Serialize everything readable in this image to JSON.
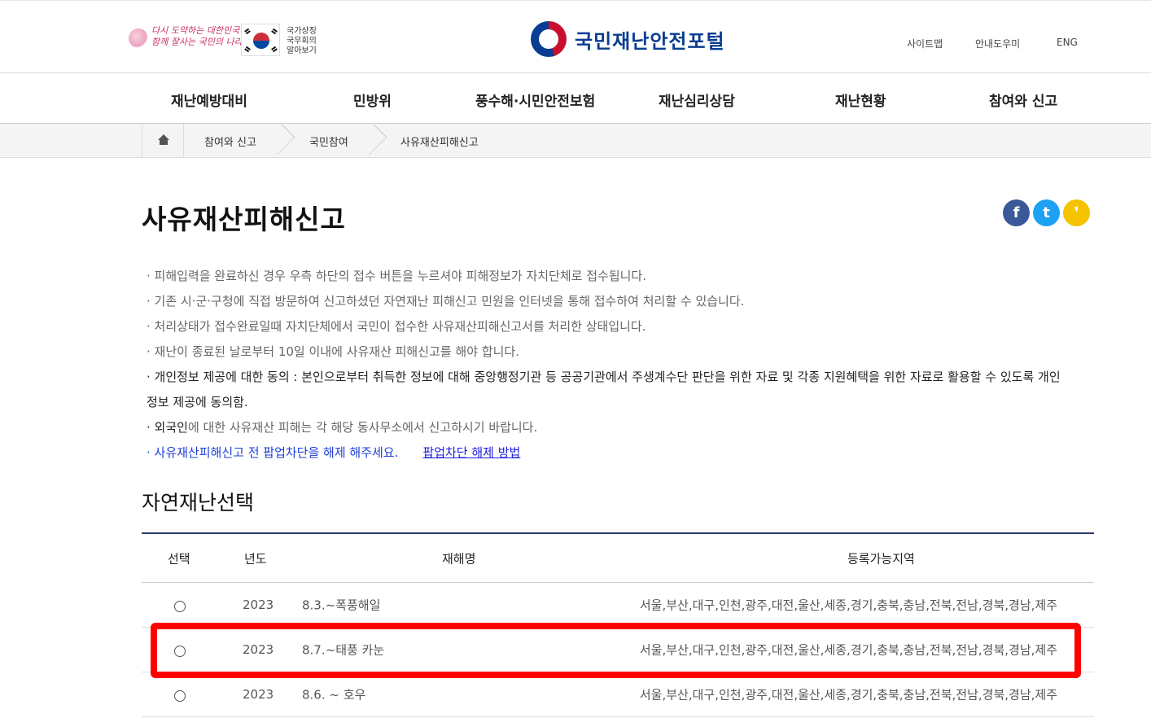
{
  "header": {
    "slogan_lines": [
      "다시 도약하는 대한민국",
      "함께 잘사는 국민의 나라"
    ],
    "symbol_text_lines": [
      "국가상징",
      "국무회의",
      "알아보기"
    ],
    "logo_text": "국민재난안전포털",
    "util_links": [
      "사이트맵",
      "안내도우미",
      "ENG"
    ]
  },
  "gnb": [
    "재난예방대비",
    "민방위",
    "풍수해·시민안전보험",
    "재난심리상담",
    "재난현황",
    "참여와 신고"
  ],
  "breadcrumb": [
    "참여와 신고",
    "국민참여",
    "사유재산피해신고"
  ],
  "page_title": "사유재산피해신고",
  "share": [
    {
      "icon": "facebook-icon",
      "glyph": "f",
      "color": "#3b5998"
    },
    {
      "icon": "twitter-icon",
      "glyph": "t",
      "color": "#1da1f2"
    },
    {
      "icon": "kakaostory-icon",
      "glyph": "❜",
      "color": "#f5c300"
    }
  ],
  "notices": [
    "· 피해입력을 완료하신 경우 우측 하단의 접수 버튼을 누르셔야 피해정보가 자치단체로 접수됩니다.",
    "· 기존 시·군·구청에 직접 방문하여 신고하셨던 자연재난 피해신고 민원을 인터넷을 통해 접수하여 처리할 수 있습니다.",
    "· 처리상태가 접수완료일때 자치단체에서 국민이 접수한 사유재산피해신고서를 처리한 상태입니다.",
    "· 재난이 종료된 날로부터 10일 이내에 사유재산 피해신고를 해야 합니다."
  ],
  "consent_notice": "· 개인정보 제공에 대한 동의 : 본인으로부터 취득한 정보에 대해 중앙행정기관 등 공공기관에서 주생계수단 판단을 위한 자료 및 각종 지원혜택을 위한 자료로 활용할 수 있도록 개인정보 제공에 동의함.",
  "foreigner_notice": {
    "prefix": "· 외국인",
    "rest": "에 대한 사유재산 피해는 각 해당 동사무소에서 신고하시기 바랍니다."
  },
  "popup_notice": {
    "text": "· 사유재산피해신고 전 팝업차단을 해제 해주세요.",
    "link": "팝업차단 해제 방법"
  },
  "section_title": "자연재난선택",
  "table": {
    "headers": [
      "선택",
      "년도",
      "재해명",
      "등록가능지역"
    ],
    "rows": [
      {
        "year": "2023",
        "name": "8.3.~폭풍해일",
        "regions": "서울,부산,대구,인천,광주,대전,울산,세종,경기,충북,충남,전북,전남,경북,경남,제주"
      },
      {
        "year": "2023",
        "name": "8.7.~태풍 카눈",
        "regions": "서울,부산,대구,인천,광주,대전,울산,세종,경기,충북,충남,전북,전남,경북,경남,제주"
      },
      {
        "year": "2023",
        "name": "8.6. ~ 호우",
        "regions": "서울,부산,대구,인천,광주,대전,울산,세종,경기,충북,충남,전북,전남,경북,경남,제주"
      }
    ]
  },
  "colors": {
    "highlight": "#ff0000",
    "brand_blue": "#0a3d91",
    "table_top_border": "#2c3a6a"
  }
}
